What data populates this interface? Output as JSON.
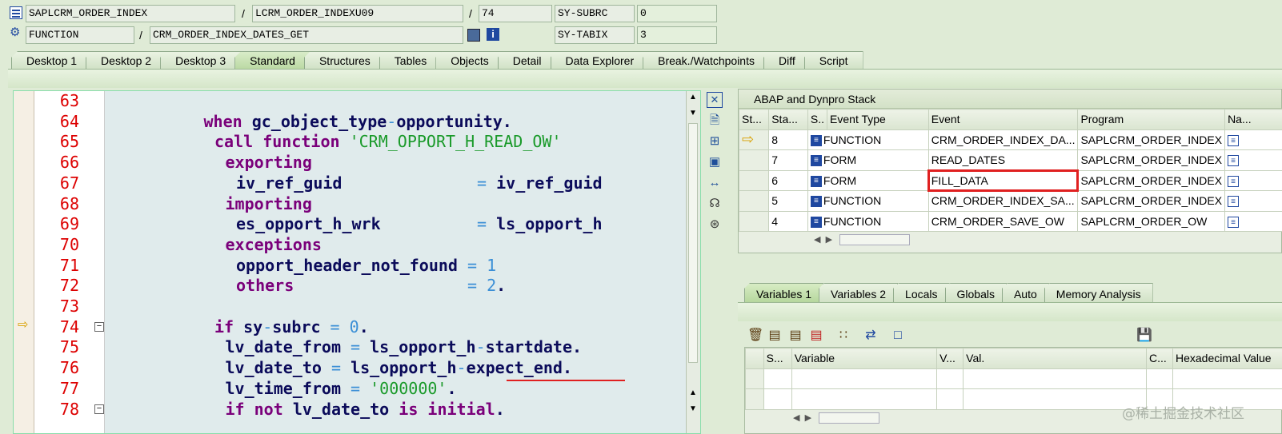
{
  "header": {
    "program": "SAPLCRM_ORDER_INDEX",
    "include": "LCRM_ORDER_INDEXU09",
    "line": "74",
    "sysvar1_label": "SY-SUBRC",
    "sysvar1_value": "0",
    "event_type": "FUNCTION",
    "event": "CRM_ORDER_INDEX_DATES_GET",
    "sysvar2_label": "SY-TABIX",
    "sysvar2_value": "3"
  },
  "tabs": [
    "Desktop 1",
    "Desktop 2",
    "Desktop 3",
    "Standard",
    "Structures",
    "Tables",
    "Objects",
    "Detail",
    "Data Explorer",
    "Break./Watchpoints",
    "Diff",
    "Script"
  ],
  "active_tab": "Standard",
  "code": [
    {
      "n": "63",
      "t": ""
    },
    {
      "n": "64",
      "t": "when gc_object_type-opportunity."
    },
    {
      "n": "65",
      "t": "call function 'CRM_OPPORT_H_READ_OW'"
    },
    {
      "n": "66",
      "t": "exporting"
    },
    {
      "n": "67",
      "t": "iv_ref_guid              = iv_ref_guid"
    },
    {
      "n": "68",
      "t": "importing"
    },
    {
      "n": "69",
      "t": "es_opport_h_wrk          = ls_opport_h"
    },
    {
      "n": "70",
      "t": "exceptions"
    },
    {
      "n": "71",
      "t": "opport_header_not_found = 1"
    },
    {
      "n": "72",
      "t": "others                  = 2."
    },
    {
      "n": "73",
      "t": ""
    },
    {
      "n": "74",
      "t": "if sy-subrc = 0."
    },
    {
      "n": "75",
      "t": "lv_date_from = ls_opport_h-startdate."
    },
    {
      "n": "76",
      "t": "lv_date_to = ls_opport_h-expect_end."
    },
    {
      "n": "77",
      "t": "lv_time_from = '000000'."
    },
    {
      "n": "78",
      "t": "if not lv_date_to is initial."
    }
  ],
  "stack": {
    "title": "ABAP and Dynpro Stack",
    "columns": [
      "St...",
      "Sta...",
      "S..",
      "Event Type",
      "Event",
      "Program",
      "Na..."
    ],
    "rows": [
      {
        "level": "8",
        "type": "FUNCTION",
        "event": "CRM_ORDER_INDEX_DA...",
        "program": "SAPLCRM_ORDER_INDEX",
        "current": true
      },
      {
        "level": "7",
        "type": "FORM",
        "event": "READ_DATES",
        "program": "SAPLCRM_ORDER_INDEX",
        "current": false
      },
      {
        "level": "6",
        "type": "FORM",
        "event": "FILL_DATA",
        "program": "SAPLCRM_ORDER_INDEX",
        "current": false,
        "highlight": true
      },
      {
        "level": "5",
        "type": "FUNCTION",
        "event": "CRM_ORDER_INDEX_SA...",
        "program": "SAPLCRM_ORDER_INDEX",
        "current": false
      },
      {
        "level": "4",
        "type": "FUNCTION",
        "event": "CRM_ORDER_SAVE_OW",
        "program": "SAPLCRM_ORDER_OW",
        "current": false
      }
    ]
  },
  "variables": {
    "tabs": [
      "Variables 1",
      "Variables 2",
      "Locals",
      "Globals",
      "Auto",
      "Memory Analysis"
    ],
    "active_tab": "Variables 1",
    "columns": [
      "S...",
      "Variable",
      "V...",
      "Val.",
      "C...",
      "Hexadecimal Value"
    ]
  },
  "watermark": "@稀土掘金技术社区",
  "colors": {
    "background": "#dfebd6",
    "line_numbers": "#dd0000",
    "keyword": "#7a007a",
    "string": "#1a9a2a",
    "number": "#3b8fd6",
    "highlight": "#e02020"
  }
}
